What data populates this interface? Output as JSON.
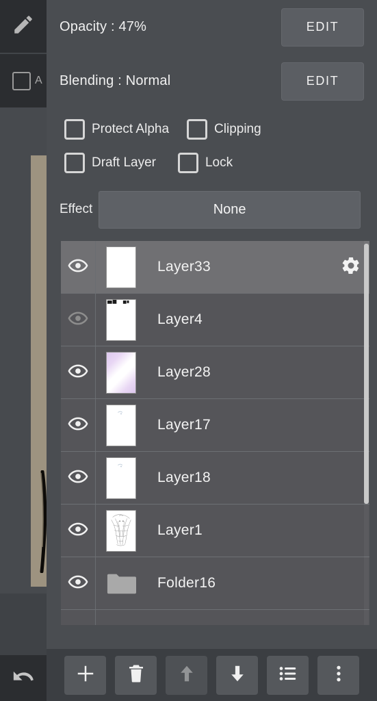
{
  "app": {
    "left_tools": {
      "pencil_icon": "pencil-icon",
      "alpha_checkbox_label": "A",
      "undo_icon": "undo-arrow-icon"
    }
  },
  "panel": {
    "opacity": {
      "label": "Opacity : 47%",
      "value": 47,
      "edit_label": "EDIT"
    },
    "blending": {
      "label": "Blending : Normal",
      "mode": "Normal",
      "edit_label": "EDIT"
    },
    "checkboxes": [
      {
        "label": "Protect Alpha",
        "checked": false
      },
      {
        "label": "Clipping",
        "checked": false
      },
      {
        "label": "Draft Layer",
        "checked": false
      },
      {
        "label": "Lock",
        "checked": false
      }
    ],
    "effect": {
      "label": "Effect",
      "value": "None"
    },
    "layers": [
      {
        "name": "Layer33",
        "visible": true,
        "selected": true,
        "type": "layer",
        "thumb": "blank",
        "gear_icon": "gear-icon"
      },
      {
        "name": "Layer4",
        "visible": false,
        "selected": false,
        "type": "layer",
        "thumb": "marks"
      },
      {
        "name": "Layer28",
        "visible": true,
        "selected": false,
        "type": "layer",
        "thumb": "gradient"
      },
      {
        "name": "Layer17",
        "visible": true,
        "selected": false,
        "type": "layer",
        "thumb": "faint"
      },
      {
        "name": "Layer18",
        "visible": true,
        "selected": false,
        "type": "layer",
        "thumb": "faint"
      },
      {
        "name": "Layer1",
        "visible": true,
        "selected": false,
        "type": "layer",
        "thumb": "sketch"
      },
      {
        "name": "Folder16",
        "visible": true,
        "selected": false,
        "type": "folder",
        "thumb": "folder"
      },
      {
        "name": "",
        "visible": false,
        "selected": false,
        "type": "folder",
        "thumb": "folder"
      }
    ]
  },
  "toolbar": {
    "buttons": [
      {
        "name": "add-layer",
        "icon": "plus-icon",
        "enabled": true
      },
      {
        "name": "delete-layer",
        "icon": "trash-icon",
        "enabled": true
      },
      {
        "name": "move-up",
        "icon": "arrow-up-icon",
        "enabled": false
      },
      {
        "name": "move-down",
        "icon": "arrow-down-icon",
        "enabled": true
      },
      {
        "name": "layer-menu",
        "icon": "list-icon",
        "enabled": true
      },
      {
        "name": "more-options",
        "icon": "more-vertical-icon",
        "enabled": true
      }
    ]
  },
  "colors": {
    "panel_bg": "#4a4d51",
    "row_bg": "#555559",
    "row_selected_bg": "#707073",
    "button_bg": "#5b5e63",
    "text": "#f0f0f0",
    "canvas_paper": "#9d9380",
    "accent_thumb": "#ddc8ee"
  }
}
